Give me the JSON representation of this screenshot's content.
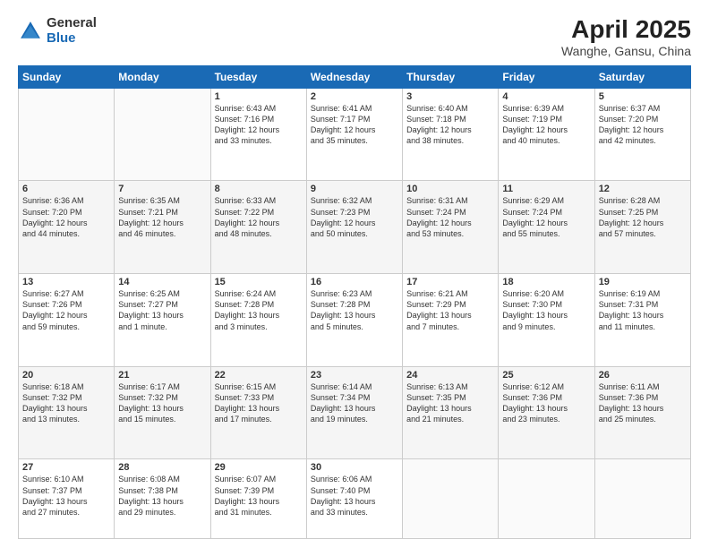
{
  "header": {
    "logo_line1": "General",
    "logo_line2": "Blue",
    "title": "April 2025",
    "subtitle": "Wanghe, Gansu, China"
  },
  "days_of_week": [
    "Sunday",
    "Monday",
    "Tuesday",
    "Wednesday",
    "Thursday",
    "Friday",
    "Saturday"
  ],
  "weeks": [
    [
      {
        "num": "",
        "info": ""
      },
      {
        "num": "",
        "info": ""
      },
      {
        "num": "1",
        "info": "Sunrise: 6:43 AM\nSunset: 7:16 PM\nDaylight: 12 hours\nand 33 minutes."
      },
      {
        "num": "2",
        "info": "Sunrise: 6:41 AM\nSunset: 7:17 PM\nDaylight: 12 hours\nand 35 minutes."
      },
      {
        "num": "3",
        "info": "Sunrise: 6:40 AM\nSunset: 7:18 PM\nDaylight: 12 hours\nand 38 minutes."
      },
      {
        "num": "4",
        "info": "Sunrise: 6:39 AM\nSunset: 7:19 PM\nDaylight: 12 hours\nand 40 minutes."
      },
      {
        "num": "5",
        "info": "Sunrise: 6:37 AM\nSunset: 7:20 PM\nDaylight: 12 hours\nand 42 minutes."
      }
    ],
    [
      {
        "num": "6",
        "info": "Sunrise: 6:36 AM\nSunset: 7:20 PM\nDaylight: 12 hours\nand 44 minutes."
      },
      {
        "num": "7",
        "info": "Sunrise: 6:35 AM\nSunset: 7:21 PM\nDaylight: 12 hours\nand 46 minutes."
      },
      {
        "num": "8",
        "info": "Sunrise: 6:33 AM\nSunset: 7:22 PM\nDaylight: 12 hours\nand 48 minutes."
      },
      {
        "num": "9",
        "info": "Sunrise: 6:32 AM\nSunset: 7:23 PM\nDaylight: 12 hours\nand 50 minutes."
      },
      {
        "num": "10",
        "info": "Sunrise: 6:31 AM\nSunset: 7:24 PM\nDaylight: 12 hours\nand 53 minutes."
      },
      {
        "num": "11",
        "info": "Sunrise: 6:29 AM\nSunset: 7:24 PM\nDaylight: 12 hours\nand 55 minutes."
      },
      {
        "num": "12",
        "info": "Sunrise: 6:28 AM\nSunset: 7:25 PM\nDaylight: 12 hours\nand 57 minutes."
      }
    ],
    [
      {
        "num": "13",
        "info": "Sunrise: 6:27 AM\nSunset: 7:26 PM\nDaylight: 12 hours\nand 59 minutes."
      },
      {
        "num": "14",
        "info": "Sunrise: 6:25 AM\nSunset: 7:27 PM\nDaylight: 13 hours\nand 1 minute."
      },
      {
        "num": "15",
        "info": "Sunrise: 6:24 AM\nSunset: 7:28 PM\nDaylight: 13 hours\nand 3 minutes."
      },
      {
        "num": "16",
        "info": "Sunrise: 6:23 AM\nSunset: 7:28 PM\nDaylight: 13 hours\nand 5 minutes."
      },
      {
        "num": "17",
        "info": "Sunrise: 6:21 AM\nSunset: 7:29 PM\nDaylight: 13 hours\nand 7 minutes."
      },
      {
        "num": "18",
        "info": "Sunrise: 6:20 AM\nSunset: 7:30 PM\nDaylight: 13 hours\nand 9 minutes."
      },
      {
        "num": "19",
        "info": "Sunrise: 6:19 AM\nSunset: 7:31 PM\nDaylight: 13 hours\nand 11 minutes."
      }
    ],
    [
      {
        "num": "20",
        "info": "Sunrise: 6:18 AM\nSunset: 7:32 PM\nDaylight: 13 hours\nand 13 minutes."
      },
      {
        "num": "21",
        "info": "Sunrise: 6:17 AM\nSunset: 7:32 PM\nDaylight: 13 hours\nand 15 minutes."
      },
      {
        "num": "22",
        "info": "Sunrise: 6:15 AM\nSunset: 7:33 PM\nDaylight: 13 hours\nand 17 minutes."
      },
      {
        "num": "23",
        "info": "Sunrise: 6:14 AM\nSunset: 7:34 PM\nDaylight: 13 hours\nand 19 minutes."
      },
      {
        "num": "24",
        "info": "Sunrise: 6:13 AM\nSunset: 7:35 PM\nDaylight: 13 hours\nand 21 minutes."
      },
      {
        "num": "25",
        "info": "Sunrise: 6:12 AM\nSunset: 7:36 PM\nDaylight: 13 hours\nand 23 minutes."
      },
      {
        "num": "26",
        "info": "Sunrise: 6:11 AM\nSunset: 7:36 PM\nDaylight: 13 hours\nand 25 minutes."
      }
    ],
    [
      {
        "num": "27",
        "info": "Sunrise: 6:10 AM\nSunset: 7:37 PM\nDaylight: 13 hours\nand 27 minutes."
      },
      {
        "num": "28",
        "info": "Sunrise: 6:08 AM\nSunset: 7:38 PM\nDaylight: 13 hours\nand 29 minutes."
      },
      {
        "num": "29",
        "info": "Sunrise: 6:07 AM\nSunset: 7:39 PM\nDaylight: 13 hours\nand 31 minutes."
      },
      {
        "num": "30",
        "info": "Sunrise: 6:06 AM\nSunset: 7:40 PM\nDaylight: 13 hours\nand 33 minutes."
      },
      {
        "num": "",
        "info": ""
      },
      {
        "num": "",
        "info": ""
      },
      {
        "num": "",
        "info": ""
      }
    ]
  ]
}
